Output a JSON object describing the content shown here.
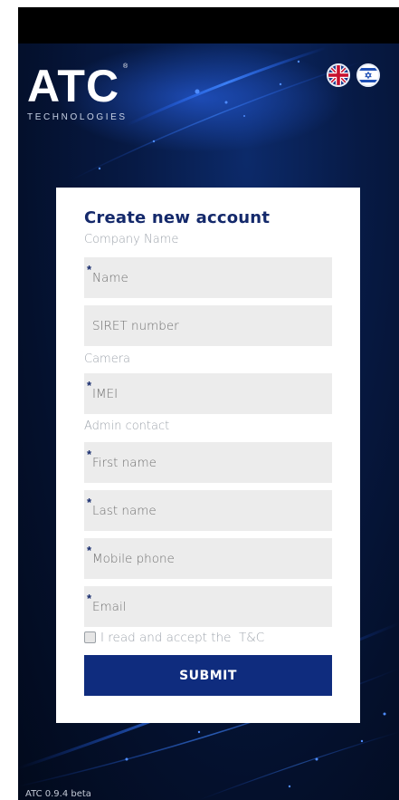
{
  "app": {
    "logo_text": "ATC",
    "logo_subtitle": "TECHNOLOGIES",
    "logo_reg": "®",
    "version": "ATC 0.9.4 beta"
  },
  "languages": [
    {
      "name": "english",
      "icon": "uk-flag-icon"
    },
    {
      "name": "hebrew",
      "icon": "israel-flag-icon"
    }
  ],
  "form": {
    "title": "Create new account",
    "sections": {
      "company": "Company Name",
      "camera": "Camera",
      "admin": "Admin contact"
    },
    "fields": {
      "name": {
        "placeholder": "Name",
        "required": true
      },
      "siret": {
        "placeholder": "SIRET number",
        "required": false
      },
      "imei": {
        "placeholder": "IMEI",
        "required": true
      },
      "first_name": {
        "placeholder": "First name",
        "required": true
      },
      "last_name": {
        "placeholder": "Last name",
        "required": true
      },
      "mobile": {
        "placeholder": "Mobile phone",
        "required": true
      },
      "email": {
        "placeholder": "Email",
        "required": true
      }
    },
    "required_marker": "*",
    "terms": {
      "label": "I read and accept the  T&C",
      "checked": false
    },
    "submit_label": "SUBMIT"
  },
  "colors": {
    "accent": "#0f2c7e",
    "title": "#14296b",
    "background": "#04102c"
  }
}
